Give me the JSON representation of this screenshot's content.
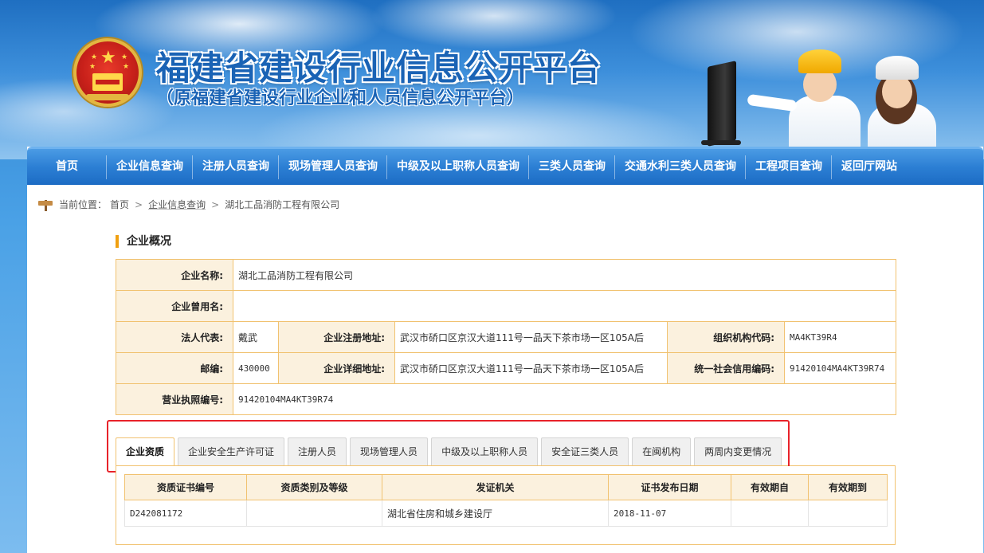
{
  "header": {
    "title": "福建省建设行业信息公开平台",
    "subtitle": "（原福建省建设行业企业和人员信息公开平台）"
  },
  "nav": {
    "items": [
      {
        "label": "首页"
      },
      {
        "label": "企业信息查询"
      },
      {
        "label": "注册人员查询"
      },
      {
        "label": "现场管理人员查询"
      },
      {
        "label": "中级及以上职称人员查询"
      },
      {
        "label": "三类人员查询"
      },
      {
        "label": "交通水利三类人员查询"
      },
      {
        "label": "工程项目查询"
      },
      {
        "label": "返回厅网站"
      }
    ]
  },
  "breadcrumb": {
    "prefix": "当前位置：",
    "items": [
      "首页",
      "企业信息查询",
      "湖北工品消防工程有限公司"
    ],
    "separator": ">"
  },
  "overview": {
    "section_title": "企业概况",
    "company_name_label": "企业名称:",
    "company_name": "湖北工品消防工程有限公司",
    "former_name_label": "企业曾用名:",
    "former_name": "",
    "legal_rep_label": "法人代表:",
    "legal_rep": "戴武",
    "reg_address_label": "企业注册地址:",
    "reg_address": "武汉市硚口区京汉大道111号一品天下茶市场一区105A后",
    "org_code_label": "组织机构代码:",
    "org_code": "MA4KT39R4",
    "postcode_label": "邮编:",
    "postcode": "430000",
    "detail_address_label": "企业详细地址:",
    "detail_address": "武汉市硚口区京汉大道111号一品天下茶市场一区105A后",
    "credit_code_label": "统一社会信用编码:",
    "credit_code": "91420104MA4KT39R74",
    "license_no_label": "营业执照编号:",
    "license_no": "91420104MA4KT39R74"
  },
  "tabs": {
    "items": [
      {
        "label": "企业资质",
        "active": true
      },
      {
        "label": "企业安全生产许可证",
        "active": false
      },
      {
        "label": "注册人员",
        "active": false
      },
      {
        "label": "现场管理人员",
        "active": false
      },
      {
        "label": "中级及以上职称人员",
        "active": false
      },
      {
        "label": "安全证三类人员",
        "active": false
      },
      {
        "label": "在闽机构",
        "active": false
      },
      {
        "label": "两周内变更情况",
        "active": false
      }
    ]
  },
  "qualifications": {
    "columns": [
      "资质证书编号",
      "资质类别及等级",
      "发证机关",
      "证书发布日期",
      "有效期自",
      "有效期到"
    ],
    "rows": [
      [
        "D242081172",
        "",
        "湖北省住房和城乡建设厅",
        "2018-11-07",
        "",
        ""
      ]
    ]
  },
  "colors": {
    "nav_blue": "#2c7fd4",
    "label_bg": "#fbf1de",
    "table_border": "#f1c270",
    "accent_orange": "#f0a010",
    "highlight_red": "#e8232a"
  }
}
